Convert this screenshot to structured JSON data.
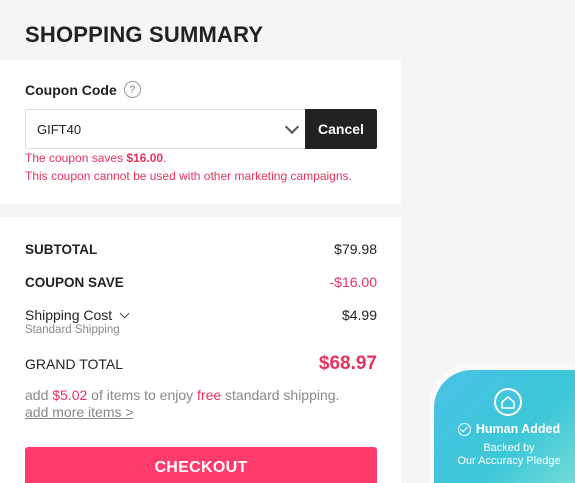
{
  "header": {
    "title": "SHOPPING SUMMARY"
  },
  "coupon": {
    "label": "Coupon Code",
    "help_icon": "question-circle-icon",
    "selected_value": "GIFT40",
    "cancel_label": "Cancel",
    "savings_prefix": "The coupon saves ",
    "savings_amount": "$16.00",
    "savings_suffix": ".",
    "warning": "This coupon cannot be used with other marketing campaigns."
  },
  "summary": {
    "subtotal_label": "SUBTOTAL",
    "subtotal_value": "$79.98",
    "coupon_save_label": "COUPON SAVE",
    "coupon_save_value": "-$16.00",
    "shipping_label": "Shipping Cost",
    "shipping_sub": "Standard Shipping",
    "shipping_value": "$4.99",
    "grand_total_label": "GRAND TOTAL",
    "grand_total_value": "$68.97",
    "free_ship_1": "add ",
    "free_ship_amount": "$5.02",
    "free_ship_2": " of items to enjoy ",
    "free_ship_free": "free",
    "free_ship_3": " standard shipping.",
    "add_more": "add more items >",
    "checkout_label": "CHECKOUT"
  },
  "badge": {
    "title": "Human Added",
    "sub1": "Backed by",
    "sub2": "Our Accuracy Pledge"
  },
  "colors": {
    "accent": "#ff3b6c",
    "accent_text": "#e8335f",
    "badge": "#3cc7d8"
  }
}
